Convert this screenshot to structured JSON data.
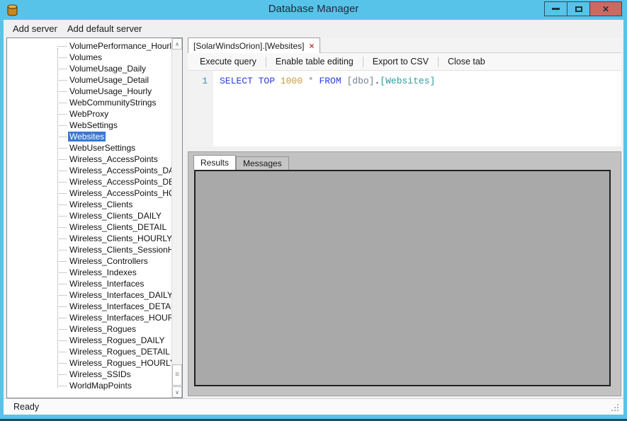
{
  "window": {
    "title": "Database Manager",
    "controls": {
      "minimize": "minimize",
      "maximize": "maximize",
      "close": "✕"
    }
  },
  "menu": {
    "items": [
      "Add server",
      "Add default server"
    ]
  },
  "tree": {
    "selected": "Websites",
    "items": [
      "VolumePerformance_Hourly",
      "Volumes",
      "VolumeUsage_Daily",
      "VolumeUsage_Detail",
      "VolumeUsage_Hourly",
      "WebCommunityStrings",
      "WebProxy",
      "WebSettings",
      "Websites",
      "WebUserSettings",
      "Wireless_AccessPoints",
      "Wireless_AccessPoints_DAILY",
      "Wireless_AccessPoints_DETAIL",
      "Wireless_AccessPoints_HOURLY",
      "Wireless_Clients",
      "Wireless_Clients_DAILY",
      "Wireless_Clients_DETAIL",
      "Wireless_Clients_HOURLY",
      "Wireless_Clients_SessionHistory",
      "Wireless_Controllers",
      "Wireless_Indexes",
      "Wireless_Interfaces",
      "Wireless_Interfaces_DAILY",
      "Wireless_Interfaces_DETAIL",
      "Wireless_Interfaces_HOURLY",
      "Wireless_Rogues",
      "Wireless_Rogues_DAILY",
      "Wireless_Rogues_DETAIL",
      "Wireless_Rogues_HOURLY",
      "Wireless_SSIDs",
      "WorldMapPoints"
    ]
  },
  "tab": {
    "label": "[SolarWindsOrion].[Websites]",
    "close_icon": "×"
  },
  "query_toolbar": {
    "items": [
      "Execute query",
      "Enable table editing",
      "Export to CSV",
      "Close tab"
    ]
  },
  "editor": {
    "line_number": "1",
    "sql_tokens": [
      {
        "text": "SELECT ",
        "type": "keyword"
      },
      {
        "text": "TOP ",
        "type": "keyword"
      },
      {
        "text": "1000 ",
        "type": "number"
      },
      {
        "text": "* ",
        "type": "operator"
      },
      {
        "text": "FROM ",
        "type": "keyword"
      },
      {
        "text": "[dbo]",
        "type": "schema"
      },
      {
        "text": ".",
        "type": "plain"
      },
      {
        "text": "[Websites]",
        "type": "object"
      }
    ]
  },
  "results": {
    "tabs": [
      {
        "label": "Results",
        "active": true
      },
      {
        "label": "Messages",
        "active": false
      }
    ]
  },
  "status": {
    "text": "Ready"
  },
  "scrollbar": {
    "up_icon": "∧",
    "down_icon": "∨",
    "grip_icon": "≡"
  },
  "colors": {
    "titlebar": "#58c3e9",
    "close_button": "#cb6a5e",
    "bottom_edge": "#1d4e68",
    "selection": "#3a77d2",
    "keyword": "#2b3fd4",
    "number": "#c79a34",
    "operator": "#8a8a8a",
    "schema": "#708090",
    "object": "#2b9aa0",
    "linenum": "#2b91af",
    "tab_close": "#b0413d"
  }
}
